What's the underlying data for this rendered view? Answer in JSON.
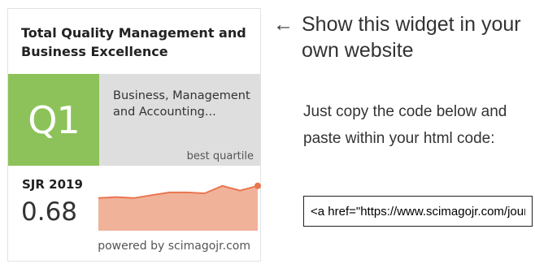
{
  "widget": {
    "journal_title": "Total Quality Management and Business Excellence",
    "quartile": "Q1",
    "category": "Business, Management and Accounting...",
    "best_quartile_label": "best quartile",
    "sjr_label": "SJR 2019",
    "sjr_value": "0.68",
    "powered_by": "powered by scimagojr.com",
    "colors": {
      "quartile_green": "#8dc25a",
      "category_gray": "#dedede",
      "chart_fill": "#f1b29a",
      "chart_line": "#e9764f"
    }
  },
  "chart_data": {
    "type": "area",
    "title": "",
    "xlabel": "",
    "ylabel": "",
    "values": [
      0.55,
      0.56,
      0.55,
      0.58,
      0.61,
      0.61,
      0.6,
      0.68,
      0.63,
      0.68
    ],
    "ylim": [
      0.2,
      0.8
    ],
    "grid": false,
    "legend": "none"
  },
  "instructions": {
    "arrow_icon": "left-arrow-icon",
    "arrow_glyph": "←",
    "heading": "Show this widget in your own website",
    "body": "Just copy the code below and paste within your html code:",
    "code_value": "<a href=\"https://www.scimagojr.com/journalsearch.php?q=&tip=sid&exact=no\" title=\"SCImago Journal &amp; Country Rank\">"
  }
}
